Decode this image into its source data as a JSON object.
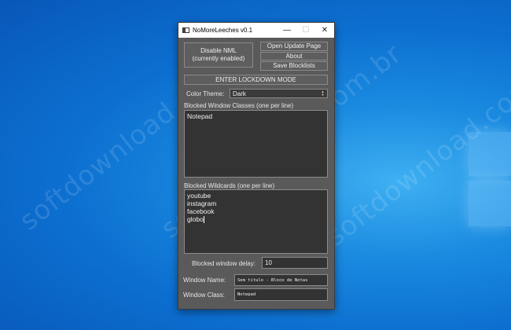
{
  "window": {
    "title": "NoMoreLeeches v0.1"
  },
  "titlebar": {
    "minimize": "—",
    "maximize": "☐",
    "close": "✕"
  },
  "buttons": {
    "disable_nml": "Disable NML\n(currently enabled)",
    "open_update_page": "Open Update Page",
    "about": "About",
    "save_blocklists": "Save Blocklists",
    "lockdown": "ENTER LOCKDOWN MODE"
  },
  "color_theme": {
    "label": "Color Theme:",
    "value": "Dark"
  },
  "blocked_classes": {
    "label": "Blocked Window Classes (one per line)",
    "lines": [
      "Notepad"
    ]
  },
  "blocked_wildcards": {
    "label": "Blocked Wildcards (one per line)",
    "lines": [
      "youtube",
      "instagram",
      "facebook",
      "globo"
    ]
  },
  "delay": {
    "label": "Blocked window delay:",
    "value": "10"
  },
  "window_name": {
    "label": "Window Name:",
    "value": "Sem título - Bloco de Notas"
  },
  "window_class": {
    "label": "Window Class:",
    "value": "Notepad"
  },
  "desktop": {
    "watermark": "softdownload.com.br"
  }
}
